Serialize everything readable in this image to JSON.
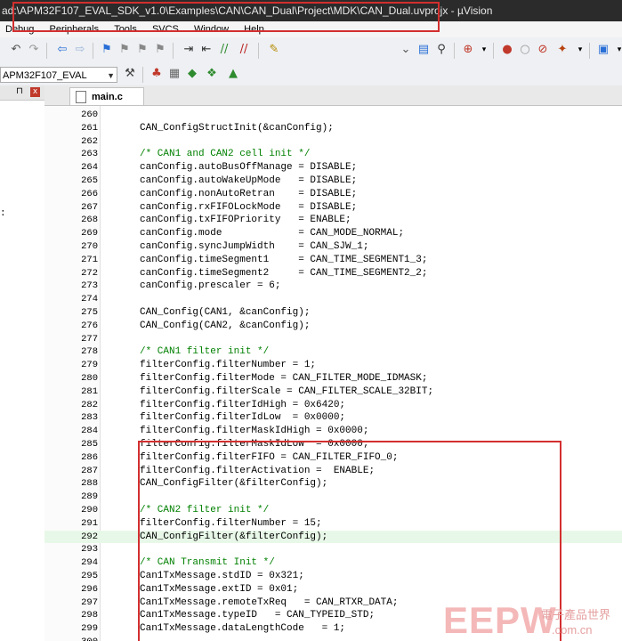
{
  "window": {
    "title": "ad:\\APM32F107_EVAL_SDK_v1.0\\Examples\\CAN\\CAN_Dual\\Project\\MDK\\CAN_Dual.uvprojx - µVision"
  },
  "menu": [
    "Debug",
    "Peripherals",
    "Tools",
    "SVCS",
    "Window",
    "Help"
  ],
  "toolbar": {
    "target": "APM32F107_EVAL"
  },
  "left_panel": {
    "pin_glyph": "⊓",
    "close_glyph": "x",
    "fragment": ":"
  },
  "editor": {
    "tab": "main.c",
    "lines": [
      {
        "n": "260",
        "t": ""
      },
      {
        "n": "261",
        "t": "CAN_ConfigStructInit(&canConfig);"
      },
      {
        "n": "262",
        "t": ""
      },
      {
        "n": "263",
        "t": "/* CAN1 and CAN2 cell init */"
      },
      {
        "n": "264",
        "t": "canConfig.autoBusOffManage = DISABLE;"
      },
      {
        "n": "265",
        "t": "canConfig.autoWakeUpMode   = DISABLE;"
      },
      {
        "n": "266",
        "t": "canConfig.nonAutoRetran    = DISABLE;"
      },
      {
        "n": "267",
        "t": "canConfig.rxFIFOLockMode   = DISABLE;"
      },
      {
        "n": "268",
        "t": "canConfig.txFIFOPriority   = ENABLE;"
      },
      {
        "n": "269",
        "t": "canConfig.mode             = CAN_MODE_NORMAL;"
      },
      {
        "n": "270",
        "t": "canConfig.syncJumpWidth    = CAN_SJW_1;"
      },
      {
        "n": "271",
        "t": "canConfig.timeSegment1     = CAN_TIME_SEGMENT1_3;"
      },
      {
        "n": "272",
        "t": "canConfig.timeSegment2     = CAN_TIME_SEGMENT2_2;"
      },
      {
        "n": "273",
        "t": "canConfig.prescaler = 6;"
      },
      {
        "n": "274",
        "t": ""
      },
      {
        "n": "275",
        "t": "CAN_Config(CAN1, &canConfig);"
      },
      {
        "n": "276",
        "t": "CAN_Config(CAN2, &canConfig);"
      },
      {
        "n": "277",
        "t": ""
      },
      {
        "n": "278",
        "t": "/* CAN1 filter init */"
      },
      {
        "n": "279",
        "t": "filterConfig.filterNumber = 1;"
      },
      {
        "n": "280",
        "t": "filterConfig.filterMode = CAN_FILTER_MODE_IDMASK;"
      },
      {
        "n": "281",
        "t": "filterConfig.filterScale = CAN_FILTER_SCALE_32BIT;"
      },
      {
        "n": "282",
        "t": "filterConfig.filterIdHigh = 0x6420;"
      },
      {
        "n": "283",
        "t": "filterConfig.filterIdLow  = 0x0000;"
      },
      {
        "n": "284",
        "t": "filterConfig.filterMaskIdHigh = 0x0000;"
      },
      {
        "n": "285",
        "t": "filterConfig.filterMaskIdLow  = 0x0000;"
      },
      {
        "n": "286",
        "t": "filterConfig.filterFIFO = CAN_FILTER_FIFO_0;"
      },
      {
        "n": "287",
        "t": "filterConfig.filterActivation =  ENABLE;"
      },
      {
        "n": "288",
        "t": "CAN_ConfigFilter(&filterConfig);"
      },
      {
        "n": "289",
        "t": ""
      },
      {
        "n": "290",
        "t": "/* CAN2 filter init */"
      },
      {
        "n": "291",
        "t": "filterConfig.filterNumber = 15;"
      },
      {
        "n": "292",
        "t": "CAN_ConfigFilter(&filterConfig);"
      },
      {
        "n": "293",
        "t": ""
      },
      {
        "n": "294",
        "t": "/* CAN Transmit Init */"
      },
      {
        "n": "295",
        "t": "Can1TxMessage.stdID = 0x321;"
      },
      {
        "n": "296",
        "t": "Can1TxMessage.extID = 0x01;"
      },
      {
        "n": "297",
        "t": "Can1TxMessage.remoteTxReq   = CAN_RTXR_DATA;"
      },
      {
        "n": "298",
        "t": "Can1TxMessage.typeID   = CAN_TYPEID_STD;"
      },
      {
        "n": "299",
        "t": "Can1TxMessage.dataLengthCode   = 1;"
      },
      {
        "n": "300",
        "t": ""
      }
    ]
  },
  "watermark": {
    "logo": "EEPW",
    "chinese": "電子產品世界",
    "url": ".com.cn"
  }
}
